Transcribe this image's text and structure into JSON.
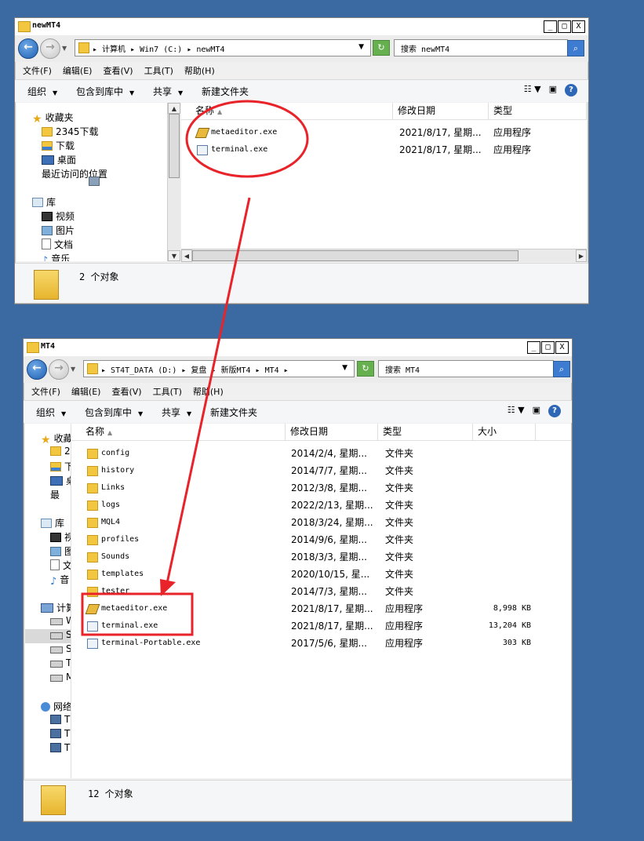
{
  "window1": {
    "title": "newMT4",
    "controls": {
      "min": "_",
      "max": "□",
      "close": "X"
    },
    "address": {
      "parts": [
        "计算机",
        "Win7 (C:)",
        "newMT4"
      ]
    },
    "search_placeholder": "搜索 newMT4",
    "menu": [
      "文件(F)",
      "编辑(E)",
      "查看(V)",
      "工具(T)",
      "帮助(H)"
    ],
    "commands": {
      "organize": "组织",
      "include_library": "包含到库中",
      "share": "共享",
      "new_folder": "新建文件夹"
    },
    "nav": {
      "favorites": "收藏夹",
      "favorites_items": [
        "2345下载",
        "下载",
        "桌面",
        "最近访问的位置"
      ],
      "libraries": "库",
      "libraries_items": [
        "视频",
        "图片",
        "文档",
        "音乐"
      ]
    },
    "columns": {
      "name": "名称",
      "modified": "修改日期",
      "type": "类型"
    },
    "files": [
      {
        "name": "metaeditor.exe",
        "modified": "2021/8/17, 星期...",
        "type": "应用程序",
        "icon": "metaeditor-icon"
      },
      {
        "name": "terminal.exe",
        "modified": "2021/8/17, 星期...",
        "type": "应用程序",
        "icon": "terminal-icon"
      }
    ],
    "status": "2 个对象"
  },
  "window2": {
    "title": "MT4",
    "controls": {
      "min": "_",
      "max": "□",
      "close": "X"
    },
    "address": {
      "parts": [
        "ST4T_DATA (D:)",
        "复盘",
        "新版MT4",
        "MT4"
      ]
    },
    "search_placeholder": "搜索 MT4",
    "menu": [
      "文件(F)",
      "编辑(E)",
      "查看(V)",
      "工具(T)",
      "帮助(H)"
    ],
    "commands": {
      "organize": "组织",
      "include_library": "包含到库中",
      "share": "共享",
      "new_folder": "新建文件夹"
    },
    "nav": {
      "favorites": "收藏夹",
      "favorites_items": [
        "2",
        "下",
        "桌",
        "最"
      ],
      "libraries": "库",
      "libraries_items": [
        "视",
        "图",
        "文",
        "音"
      ],
      "computer": "计算",
      "computer_items": [
        "W",
        "S",
        "S",
        "T",
        "M"
      ],
      "network": "网络",
      "network_items": [
        "T",
        "T",
        "T"
      ]
    },
    "columns": {
      "name": "名称",
      "modified": "修改日期",
      "type": "类型",
      "size": "大小"
    },
    "files": [
      {
        "name": "config",
        "modified": "2014/2/4, 星期...",
        "type": "文件夹",
        "size": "",
        "icon": "folder-icon"
      },
      {
        "name": "history",
        "modified": "2014/7/7, 星期...",
        "type": "文件夹",
        "size": "",
        "icon": "folder-icon"
      },
      {
        "name": "Links",
        "modified": "2012/3/8, 星期...",
        "type": "文件夹",
        "size": "",
        "icon": "folder-icon"
      },
      {
        "name": "logs",
        "modified": "2022/2/13, 星期...",
        "type": "文件夹",
        "size": "",
        "icon": "folder-icon"
      },
      {
        "name": "MQL4",
        "modified": "2018/3/24, 星期...",
        "type": "文件夹",
        "size": "",
        "icon": "folder-icon"
      },
      {
        "name": "profiles",
        "modified": "2014/9/6, 星期...",
        "type": "文件夹",
        "size": "",
        "icon": "folder-icon"
      },
      {
        "name": "Sounds",
        "modified": "2018/3/3, 星期...",
        "type": "文件夹",
        "size": "",
        "icon": "folder-icon"
      },
      {
        "name": "templates",
        "modified": "2020/10/15, 星...",
        "type": "文件夹",
        "size": "",
        "icon": "folder-icon"
      },
      {
        "name": "tester",
        "modified": "2014/7/3, 星期...",
        "type": "文件夹",
        "size": "",
        "icon": "folder-icon"
      },
      {
        "name": "metaeditor.exe",
        "modified": "2021/8/17, 星期...",
        "type": "应用程序",
        "size": "8,998 KB",
        "icon": "metaeditor-icon"
      },
      {
        "name": "terminal.exe",
        "modified": "2021/8/17, 星期...",
        "type": "应用程序",
        "size": "13,204 KB",
        "icon": "terminal-icon"
      },
      {
        "name": "terminal-Portable.exe",
        "modified": "2017/5/6, 星期...",
        "type": "应用程序",
        "size": "303 KB",
        "icon": "terminal-icon"
      }
    ],
    "status": "12 个对象"
  },
  "annotation": {
    "color": "#e8232a"
  }
}
